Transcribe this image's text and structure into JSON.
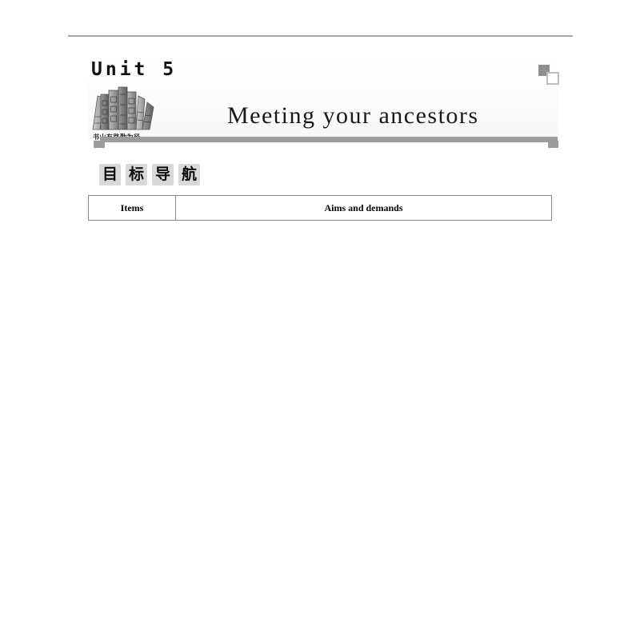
{
  "page": {
    "background_color": "#ffffff",
    "rule_color": "#a6a6a6",
    "accent_gray": "#9c9c9c",
    "box_gray": "#d9d9d9"
  },
  "header": {
    "unit_label": "Unit 5",
    "unit_title": "Meeting your ancestors",
    "books_caption": "书山有路勤为径"
  },
  "decoration": {
    "square_filled_color": "#8f8f8f",
    "square_outline_color": "#bdbdbd"
  },
  "section_heading": {
    "full_text": "目标导航",
    "chars": [
      "目",
      "标",
      "导",
      "航"
    ]
  },
  "table": {
    "columns": [
      "Items",
      "Aims and demands"
    ],
    "rows": []
  }
}
